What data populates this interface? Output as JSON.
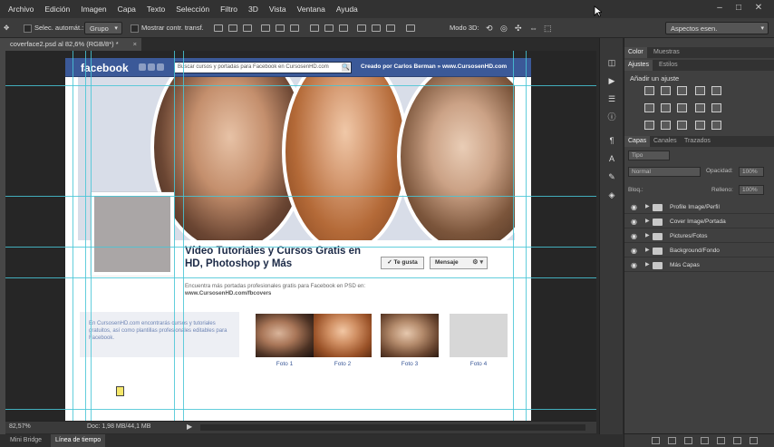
{
  "menu": [
    "Archivo",
    "Edición",
    "Imagen",
    "Capa",
    "Texto",
    "Selección",
    "Filtro",
    "3D",
    "Vista",
    "Ventana",
    "Ayuda"
  ],
  "window_controls": {
    "minimize": "–",
    "restore": "□",
    "close": "✕"
  },
  "options_bar": {
    "auto_select_label": "Selec. automát.:",
    "auto_select_value": "Grupo",
    "show_transform_label": "Mostrar contr. transf.",
    "mode3d_label": "Modo 3D:",
    "workspace_value": "Aspectos esen."
  },
  "document_tab": {
    "title": "coverface2.psd al 82,6% (RGB/8*) *",
    "close": "×"
  },
  "facebook": {
    "logo": "facebook",
    "search_placeholder": "Buscar cursos y portadas para Facebook en CursosenHD.com",
    "search_icon": "🔍",
    "credit": "Creado por Carlos Berman  » www.CursosenHD.com",
    "headline": "Vídeo Tutoriales y Cursos Gratis en HD, Photoshop y Más",
    "like_button": "✓ Te gusta",
    "message_button": "Mensaje",
    "message_gear": "⚙ ▾",
    "description": "Encuentra más portadas profesionales gratis para Facebook en PSD en:",
    "description_url": "www.CursosenHD.com/fbcovers",
    "info_text": "En CursosenHD.com encontrarás cursos y tutoriales gratuitos, así como plantillas profesionales editables para Facebook.",
    "captions": [
      "Foto 1",
      "Foto 2",
      "Foto 3",
      "Foto 4"
    ]
  },
  "status": {
    "zoom": "82,57%",
    "doc_size": "Doc: 1,98 MB/44,1 MB",
    "arrow": "▶"
  },
  "bottom_tabs": [
    "Mini Bridge",
    "Línea de tiempo"
  ],
  "panels": {
    "color_tabs": [
      "Color",
      "Muestras"
    ],
    "adjust_tabs": [
      "Ajustes",
      "Estilos"
    ],
    "adjust_title": "Añadir un ajuste",
    "layers_tabs": [
      "Capas",
      "Canales",
      "Trazados"
    ],
    "kind_value": "Tipo",
    "blend_value": "Normal",
    "opacity_label": "Opacidad:",
    "opacity_value": "100%",
    "lock_label": "Bloq.:",
    "fill_label": "Relleno:",
    "fill_value": "100%",
    "layers": [
      "Profile Image/Perfil",
      "Cover Image/Portada",
      "Pictures/Fotos",
      "Background/Fondo",
      "Más Capas"
    ]
  },
  "accent_colors": {
    "facebook_blue": "#3b5998",
    "guide_cyan": "#48c6d6"
  }
}
